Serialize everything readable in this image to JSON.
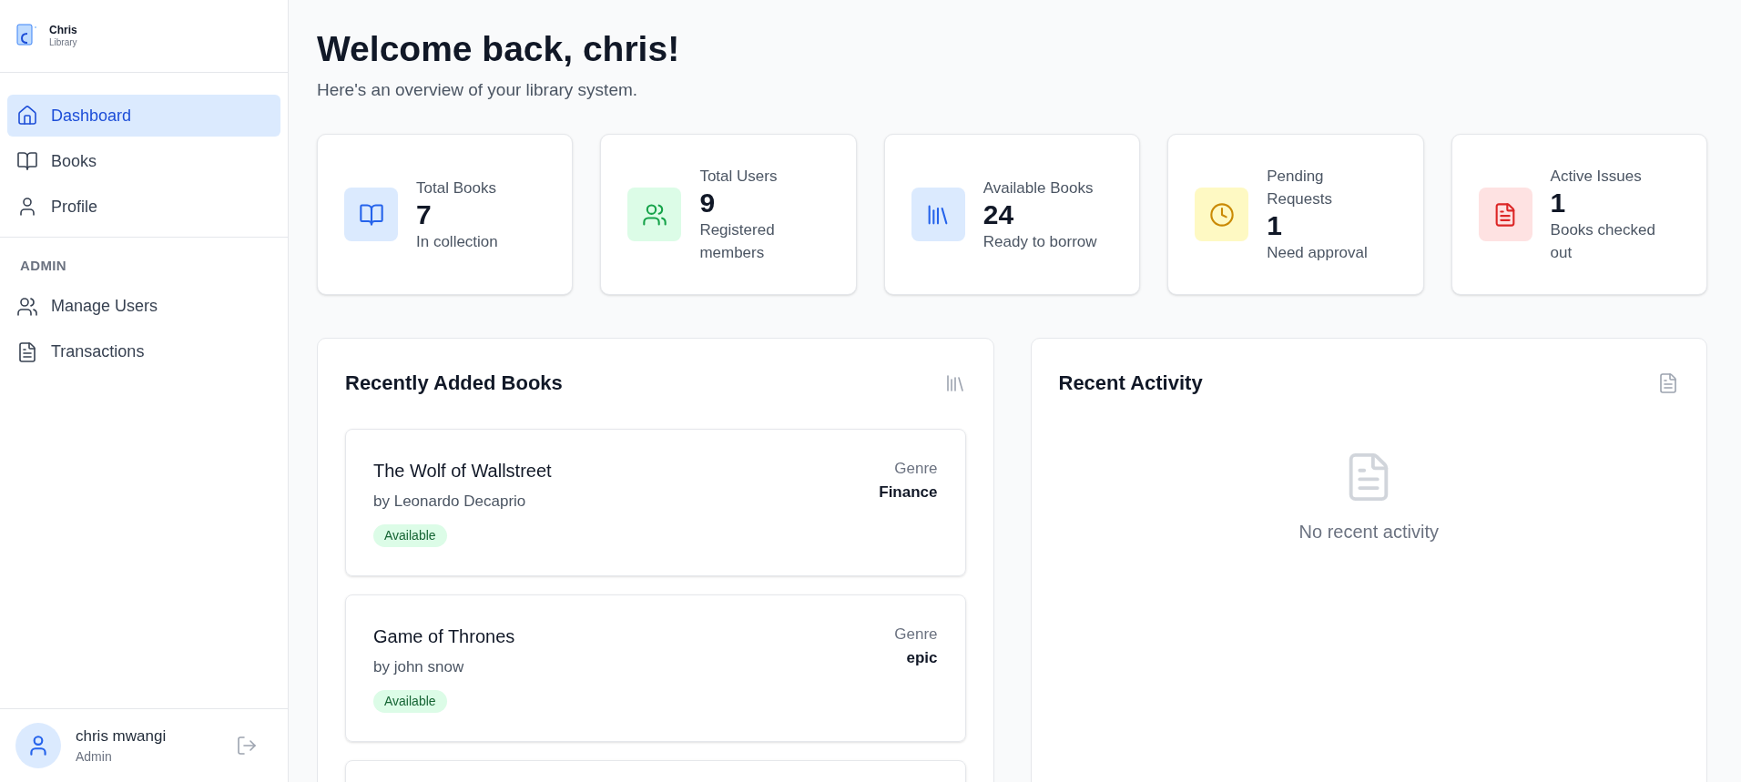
{
  "brand": {
    "name": "Chris",
    "subtitle": "Library"
  },
  "nav": [
    {
      "label": "Dashboard",
      "kind": "home",
      "selected": true
    },
    {
      "label": "Books",
      "kind": "book",
      "selected": false
    },
    {
      "label": "Profile",
      "kind": "user",
      "selected": false
    }
  ],
  "admin_section": {
    "heading": "ADMIN",
    "items": [
      {
        "label": "Manage Users",
        "kind": "users",
        "selected": false
      },
      {
        "label": "Transactions",
        "kind": "file",
        "selected": false
      }
    ]
  },
  "user": {
    "name": "chris mwangi",
    "role": "Admin"
  },
  "header": {
    "title": "Welcome back, chris!",
    "subtitle": "Here's an overview of your library system."
  },
  "stats": [
    {
      "kind": "books",
      "label": "Total Books",
      "value": "7",
      "note": "In collection"
    },
    {
      "kind": "users",
      "label": "Total Users",
      "value": "9",
      "note": "Registered members"
    },
    {
      "kind": "available",
      "label": "Available Books",
      "value": "24",
      "note": "Ready to borrow"
    },
    {
      "kind": "pending",
      "label": "Pending Requests",
      "value": "1",
      "note": "Need approval"
    },
    {
      "kind": "issues",
      "label": "Active Issues",
      "value": "1",
      "note": "Books checked out"
    }
  ],
  "recent_books": {
    "title": "Recently Added Books",
    "books": [
      {
        "title": "The Wolf of Wallstreet",
        "author": "by Leonardo Decaprio",
        "genre_label": "Genre",
        "genre": "Finance",
        "status": "Available",
        "available": true
      },
      {
        "title": "Game of Thrones",
        "author": "by john snow",
        "genre_label": "Genre",
        "genre": "epic",
        "status": "Available",
        "available": true
      }
    ]
  },
  "recent_activity": {
    "title": "Recent Activity",
    "empty_text": "No recent activity"
  }
}
